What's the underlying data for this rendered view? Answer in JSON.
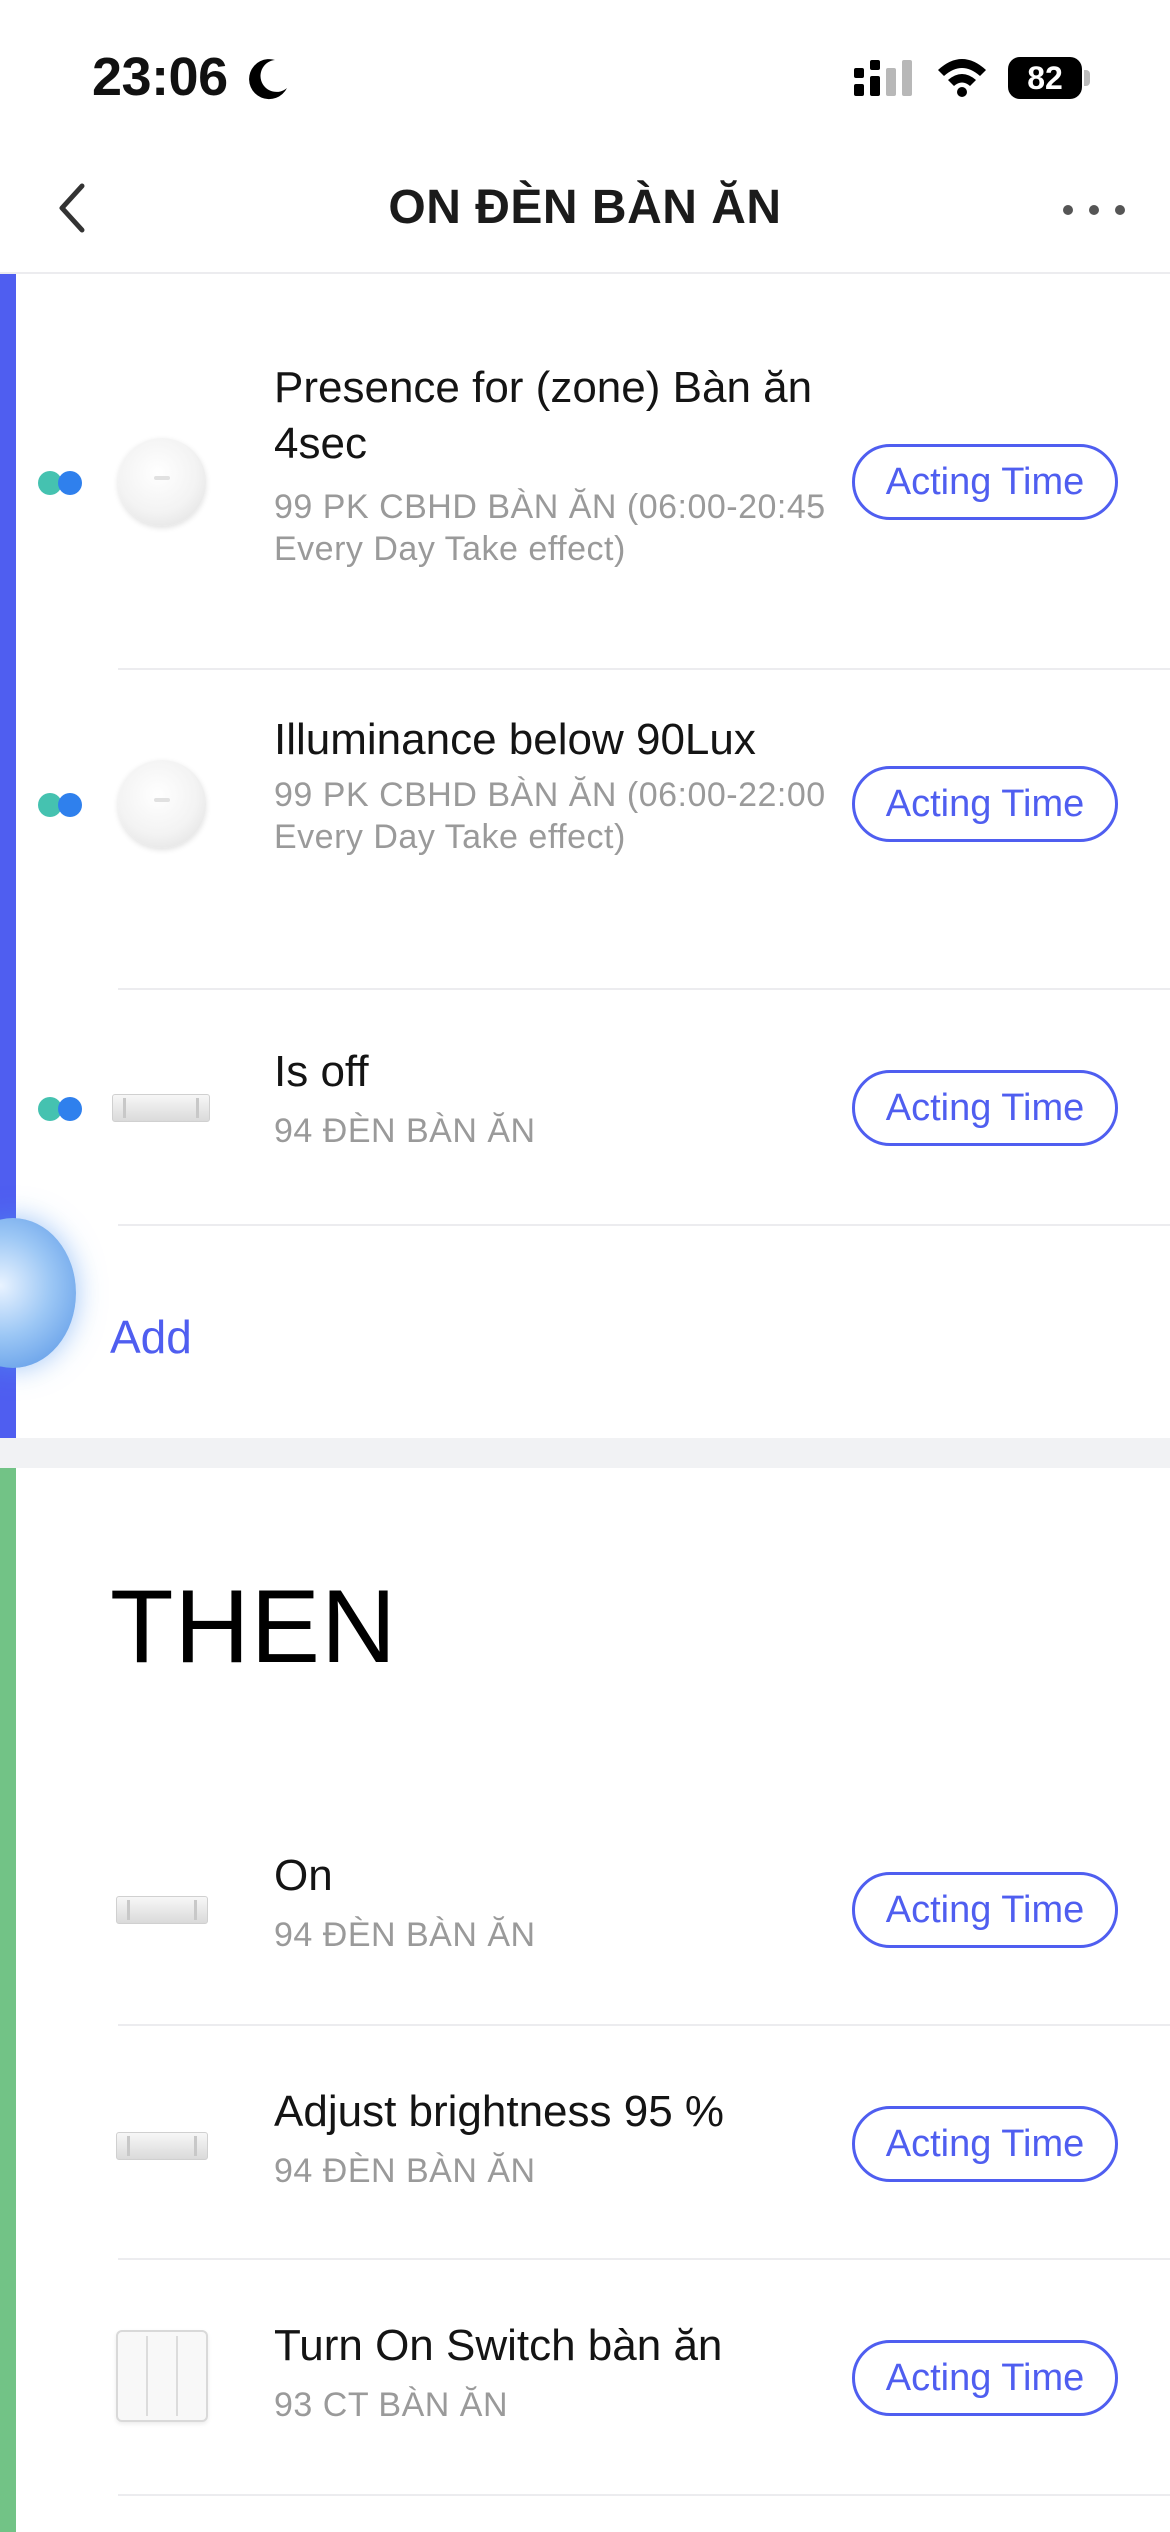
{
  "status_bar": {
    "time": "23:06",
    "battery": "82"
  },
  "header": {
    "title": "ON ĐÈN BÀN ĂN"
  },
  "if_section": {
    "conditions": [
      {
        "title": "Presence for (zone) Bàn ăn 4sec",
        "subtitle": "99 PK CBHD BÀN ĂN (06:00-20:45 Every Day Take effect)",
        "button": "Acting Time",
        "device_icon": "presence-sensor-icon"
      },
      {
        "title": "Illuminance below 90Lux",
        "subtitle": "99 PK CBHD BÀN ĂN (06:00-22:00 Every Day Take effect)",
        "button": "Acting Time",
        "device_icon": "presence-sensor-icon"
      },
      {
        "title": "Is off",
        "subtitle": "94 ĐÈN BÀN ĂN",
        "button": "Acting Time",
        "device_icon": "light-bar-icon"
      }
    ],
    "add_label": "Add"
  },
  "then_section": {
    "heading": "THEN",
    "actions": [
      {
        "title": "On",
        "subtitle": "94 ĐÈN BÀN ĂN",
        "button": "Acting Time",
        "device_icon": "light-bar-icon"
      },
      {
        "title": "Adjust brightness 95 %",
        "subtitle": "94 ĐÈN BÀN ĂN",
        "button": "Acting Time",
        "device_icon": "light-bar-icon"
      },
      {
        "title": "Turn On Switch bàn ăn",
        "subtitle": "93 CT BÀN ĂN",
        "button": "Acting Time",
        "device_icon": "wall-switch-icon"
      }
    ]
  },
  "colors": {
    "accent": "#4f5ef0",
    "if_bar": "#4f5ef0",
    "then_bar": "#72c386",
    "subtitle": "#9a9a9a"
  }
}
